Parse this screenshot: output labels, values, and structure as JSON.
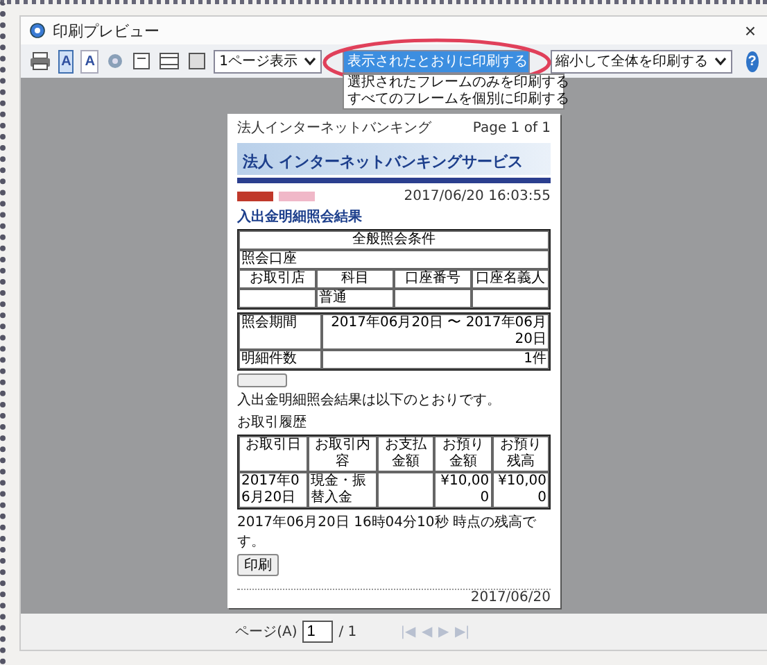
{
  "window": {
    "title": "印刷プレビュー",
    "close": "×"
  },
  "toolbar": {
    "orientation_buttons": [
      {
        "label": "A",
        "selected": true
      },
      {
        "label": "A",
        "selected": false
      }
    ],
    "view_select": {
      "value": "1ページ表示"
    },
    "frame_select": {
      "expanded": true,
      "options": [
        {
          "label": "表示されたとおりに印刷する",
          "selected": true
        },
        {
          "label": "選択されたフレームのみを印刷する",
          "selected": false
        },
        {
          "label": "すべてのフレームを個別に印刷する",
          "selected": false
        }
      ]
    },
    "scale_select": {
      "value": "縮小して全体を印刷する"
    },
    "help": "?"
  },
  "preview_page": {
    "header_left": "法人インターネットバンキング",
    "header_right": "Page 1 of 1",
    "banner_title": "法人 インターネットバンキングサービス",
    "timestamp": "2017/06/20 16:03:55",
    "heading": "入出金明細照会結果",
    "conditions": {
      "title": "全般照会条件",
      "label": "照会口座",
      "columns": [
        "お取引店",
        "科目",
        "口座番号",
        "口座名義人"
      ],
      "row": {
        "subject": "普通"
      }
    },
    "period": [
      [
        "照会期間",
        "2017年06月20日 〜 2017年06月20日"
      ],
      [
        "明細件数",
        "1件"
      ]
    ],
    "message": "入出金明細照会結果は以下のとおりです。",
    "history_title": "お取引履歴",
    "history": {
      "columns": [
        "お取引日",
        "お取引内容",
        "お支払金額",
        "お預り金額",
        "お預り残高"
      ],
      "rows": [
        [
          "2017年06月20日",
          "現金・振替入金",
          null,
          "¥10,000",
          "¥10,000"
        ]
      ]
    },
    "balance_note": "2017年06月20日 16時04分10秒 時点の残高です。",
    "print_button": "印刷",
    "footer_right": "2017/06/20"
  },
  "pager": {
    "label": "ページ(A)",
    "value": "1",
    "total": "/ 1",
    "nav": [
      "|◀",
      "◀",
      "▶",
      "▶|"
    ]
  }
}
